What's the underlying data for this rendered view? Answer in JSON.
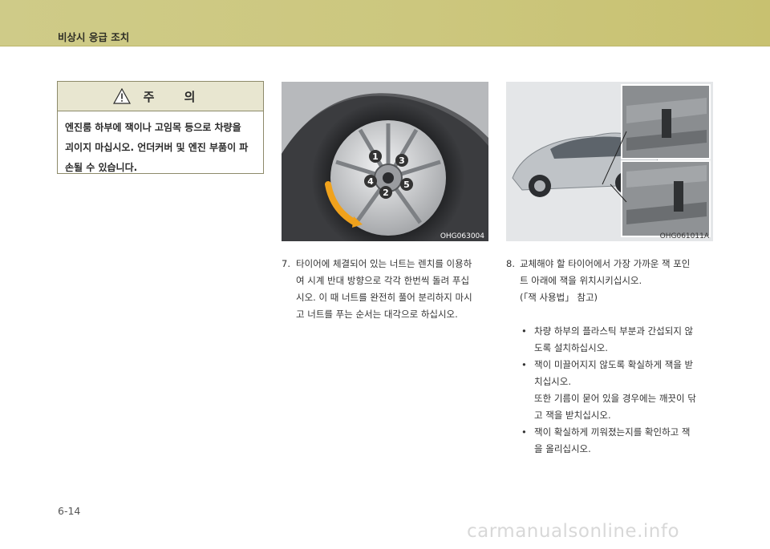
{
  "header": {
    "title": "비상시 응급 조치"
  },
  "caution": {
    "title": "주 의",
    "lines": [
      "엔진룸 하부에 잭이나 고임목 등으로 차량을",
      "괴이지 마십시오. 언더커버 및 엔진 부품이 파",
      "손될 수 있습니다."
    ]
  },
  "figure_left": {
    "code": "OHG063004",
    "callouts": [
      "1",
      "2",
      "3",
      "4",
      "5"
    ]
  },
  "figure_right": {
    "code": "OHG061011A"
  },
  "step7": {
    "number": "7.",
    "lines": [
      "타이어에 체결되어 있는 너트는 렌치를 이용하",
      "여 시계 반대 방향으로 각각 한번씩 돌려 푸십",
      "시오.  이 때 너트를 완전히 풀어 분리하지 마시",
      "고 너트를 푸는 순서는 대각으로 하십시오."
    ]
  },
  "step8": {
    "number": "8.",
    "lines": [
      "교체해야 할 타이어에서 가장 가까운 잭 포인",
      "트 아래에 잭을 위치시키십시오."
    ],
    "reference": "(「잭 사용법」 참고)"
  },
  "bullets": [
    {
      "marker": "•",
      "lines": [
        "차량 하부의 플라스틱 부분과 간섭되지 않",
        "도록 설치하십시오."
      ]
    },
    {
      "marker": "•",
      "lines": [
        "잭이 미끌어지지 않도록 확실하게 잭을 받",
        "치십시오.",
        "또한 기름이 묻어 있을 경우에는 깨끗이 닦",
        "고 잭을 받치십시오."
      ]
    },
    {
      "marker": "•",
      "lines": [
        "잭이 확실하게 끼워졌는지를 확인하고 잭",
        "을 올리십시오."
      ]
    }
  ],
  "footer": {
    "page_number": "6-14",
    "watermark": "carmanualsonline.info"
  }
}
